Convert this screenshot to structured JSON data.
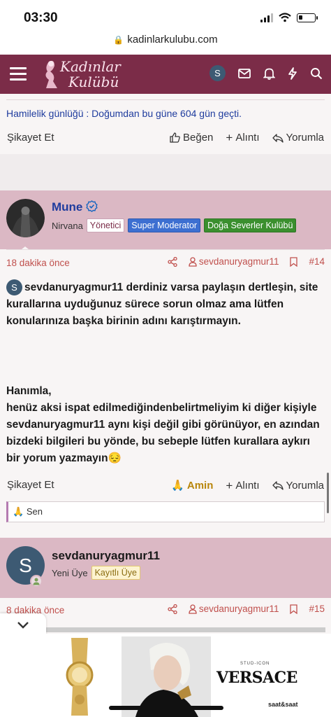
{
  "status_bar": {
    "time": "03:30"
  },
  "browser": {
    "url": "kadinlarkulubu.com"
  },
  "header": {
    "logo_line1": "Kadınlar",
    "logo_line2": "Kulübü",
    "avatar_letter": "S"
  },
  "top_post": {
    "signature": "Hamilelik günlüğü : Doğumdan bu güne 604 gün geçti.",
    "actions": {
      "report": "Şikayet Et",
      "like": "Beğen",
      "quote": "Alıntı",
      "reply": "Yorumla"
    }
  },
  "post_14": {
    "author": "Mune",
    "role": "Nirvana",
    "badges": [
      "Yönetici",
      "Super Moderator",
      "Doğa Severler Kulübü"
    ],
    "time": "18 dakika önce",
    "mention": "sevdanuryagmur11",
    "number": "#14",
    "paragraph1_mention": "sevdanuryagmur11",
    "paragraph1": "derdiniz varsa paylaşın dertleşin, site kurallarına uyduğunuz sürece sorun olmaz ama lütfen konularınıza başka birinin adını karıştırmayın.",
    "paragraph2": "Hanımla,",
    "paragraph3": "henüz aksi ispat edilmediğindenbelirtmeliyim ki diğer kişiyle sevdanuryagmur11 aynı kişi değil gibi görünüyor, en azından bizdeki bilgileri bu yönde, bu sebeple lütfen kurallara aykırı bir yorum yazmayın",
    "emoji": "😔",
    "actions": {
      "report": "Şikayet Et",
      "react": "Amin",
      "quote": "Alıntı",
      "reply": "Yorumla"
    },
    "reaction_emoji": "🙏",
    "reaction_text": "Sen"
  },
  "post_15": {
    "author": "sevdanuryagmur11",
    "avatar_letter": "S",
    "role": "Yeni Üye",
    "badge": "Kayıtlı Üye",
    "time": "8 dakika önce",
    "mention": "sevdanuryagmur11",
    "number": "#15"
  },
  "ad": {
    "brand": "VERSACE",
    "brand_small": "STUD-ICON",
    "retailer": "saat&saat"
  },
  "colors": {
    "header": "#7b2c48",
    "userband": "#dbb8c4",
    "meta": "#c0504d",
    "link": "#1f3c9e",
    "verify": "#1565c0"
  }
}
